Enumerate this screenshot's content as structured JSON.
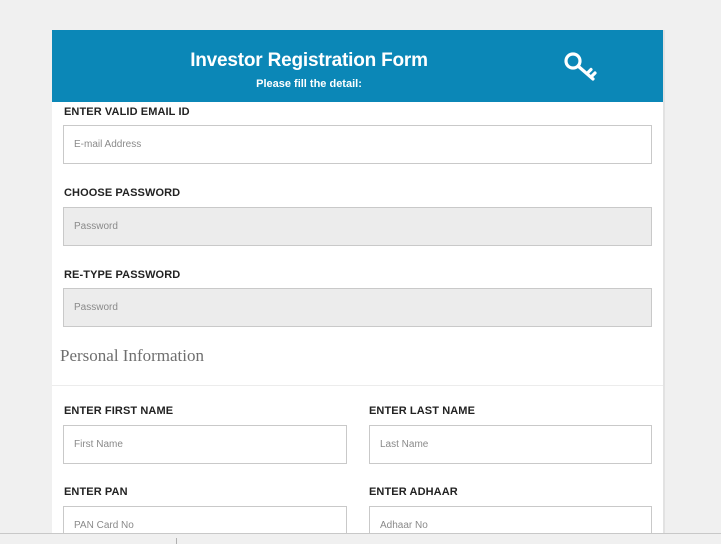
{
  "header": {
    "title": "Investor Registration Form",
    "subtitle": "Please fill the detail:",
    "icon": "key-icon",
    "color": "#0b87b7"
  },
  "account": {
    "email": {
      "label": "ENTER VALID EMAIL ID",
      "placeholder": "E-mail Address"
    },
    "password": {
      "label": "CHOOSE PASSWORD",
      "placeholder": "Password"
    },
    "retype_password": {
      "label": "RE-TYPE PASSWORD",
      "placeholder": "Password"
    }
  },
  "personal": {
    "section_title": "Personal Information",
    "first_name": {
      "label": "ENTER FIRST NAME",
      "placeholder": "First Name"
    },
    "last_name": {
      "label": "ENTER LAST NAME",
      "placeholder": "Last Name"
    },
    "pan": {
      "label": "ENTER PAN",
      "placeholder": "PAN Card No"
    },
    "adhaar": {
      "label": "ENTER ADHAAR",
      "placeholder": "Adhaar No"
    }
  }
}
